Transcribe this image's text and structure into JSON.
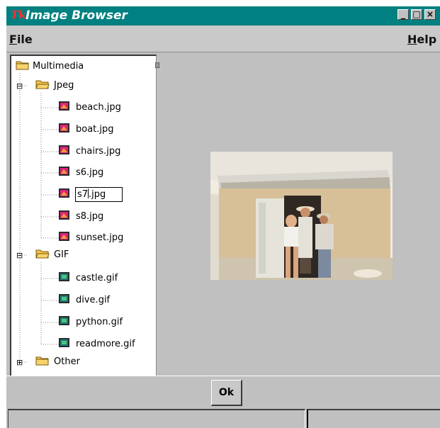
{
  "window": {
    "title": "Image Browser",
    "logo_text": "Tk",
    "controls": {
      "minimize": "_",
      "maximize": "□",
      "close": "×"
    }
  },
  "menubar": {
    "file": {
      "mnemonic": "F",
      "rest": "ile"
    },
    "help": {
      "mnemonic": "H",
      "rest": "elp"
    }
  },
  "tree": {
    "root": "Multimedia",
    "folders": [
      {
        "label": "Jpeg",
        "expanded": true,
        "expander": "⊟",
        "files": [
          "beach.jpg",
          "boat.jpg",
          "chairs.jpg",
          "s6.jpg",
          "s7.jpg",
          "s8.jpg",
          "sunset.jpg"
        ]
      },
      {
        "label": "GIF",
        "expanded": true,
        "expander": "⊟",
        "files": [
          "castle.gif",
          "dive.gif",
          "python.gif",
          "readmore.gif"
        ]
      },
      {
        "label": "Other",
        "expanded": false,
        "expander": "⊞",
        "files": []
      }
    ],
    "editing": {
      "value_before_caret": "s7",
      "value_after_caret": ".jpg"
    }
  },
  "footer": {
    "ok_label": "Ok"
  },
  "colors": {
    "titlebar": "#008080",
    "window_bg": "#bfbfbf",
    "tree_bg": "#ffffff",
    "folder": "#f2c24a",
    "jpeg_icon": "#e0217a",
    "gif_icon": "#1a7a7a"
  },
  "icons": {
    "folder": "folder-icon",
    "jpeg_file": "jpeg-file-icon",
    "gif_file": "gif-file-icon"
  }
}
